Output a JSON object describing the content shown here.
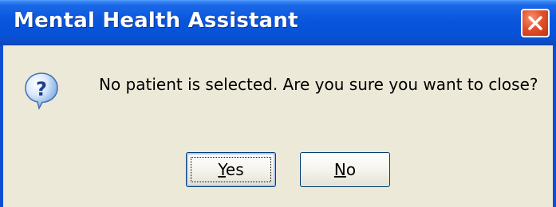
{
  "window": {
    "title": "Mental Health Assistant",
    "close_icon": "close-icon",
    "colors": {
      "titlebar": "#0a55dc",
      "close_button": "#e2512a",
      "client_background": "#ece9d8"
    }
  },
  "dialog": {
    "icon": "question-icon",
    "message": "No patient is selected.  Are you sure you want to close?"
  },
  "buttons": {
    "yes": {
      "label_mnemonic": "Y",
      "label_rest": "es",
      "label": "Yes",
      "is_default": true
    },
    "no": {
      "label_mnemonic": "N",
      "label_rest": "o",
      "label": "No",
      "is_default": false
    }
  }
}
